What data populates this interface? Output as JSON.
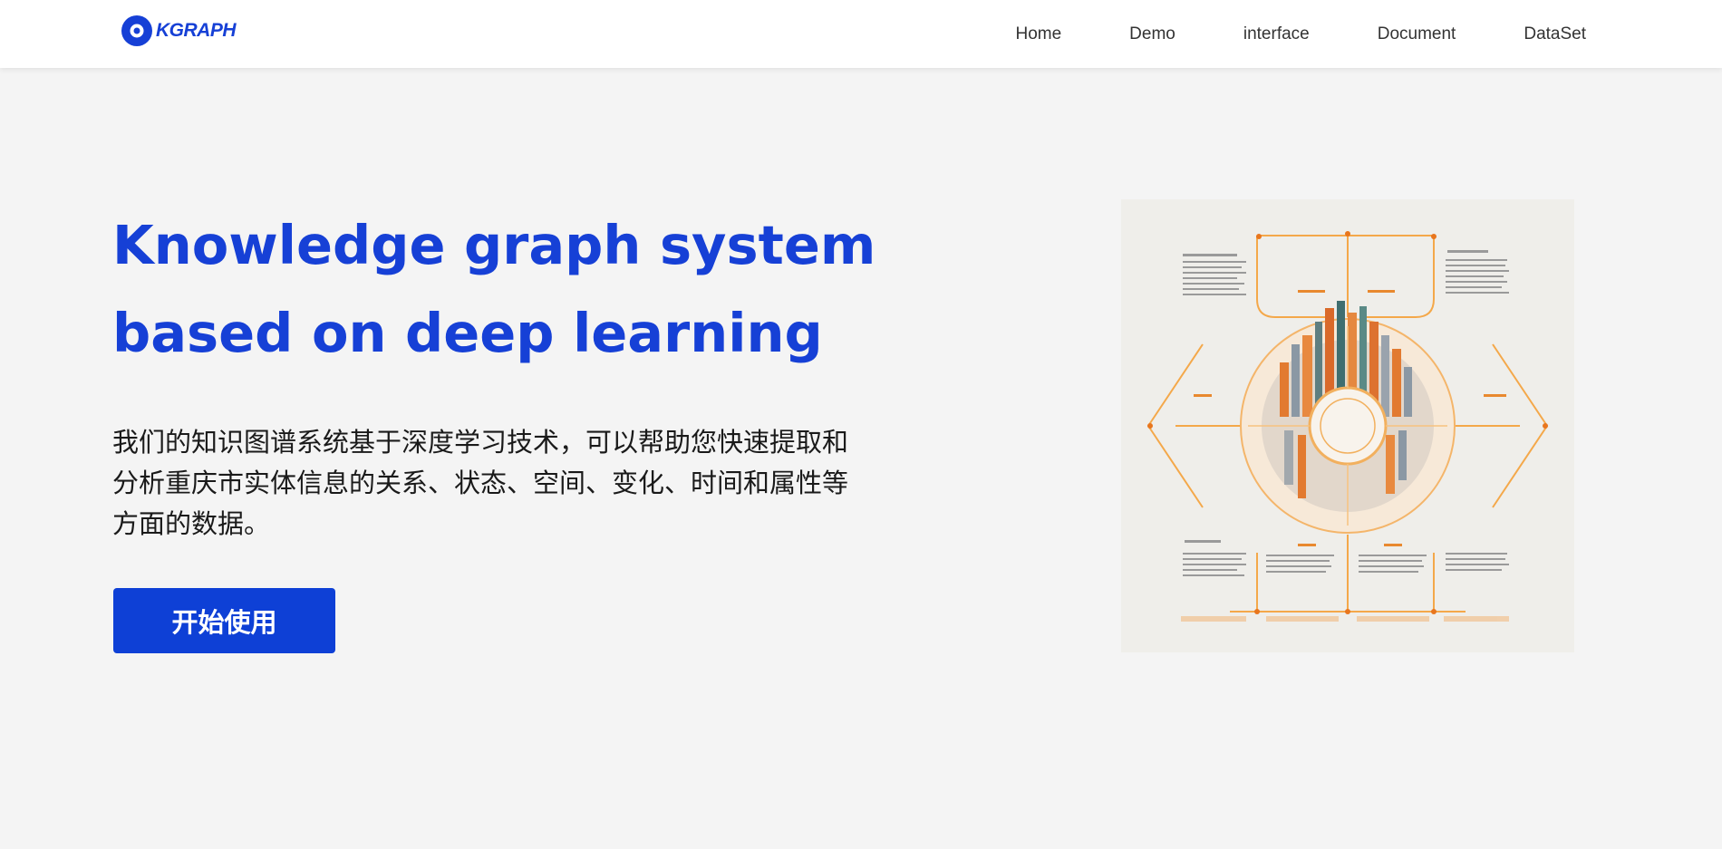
{
  "brand": {
    "logo_text": "KGRAPH",
    "accent_color": "#1640d6"
  },
  "nav": {
    "items": [
      {
        "label": "Home"
      },
      {
        "label": "Demo"
      },
      {
        "label": "interface"
      },
      {
        "label": "Document"
      },
      {
        "label": "DataSet"
      }
    ]
  },
  "hero": {
    "title": "Knowledge graph system\nbased on deep learning",
    "description": "我们的知识图谱系统基于深度学习技术，可以帮助您快速提取和分析重庆市实体信息的关系、状态、空间、变化、时间和属性等方面的数据。",
    "cta_label": "开始使用",
    "cta_color": "#0e40d6",
    "image_icon": "knowledge-graph-infographic"
  }
}
